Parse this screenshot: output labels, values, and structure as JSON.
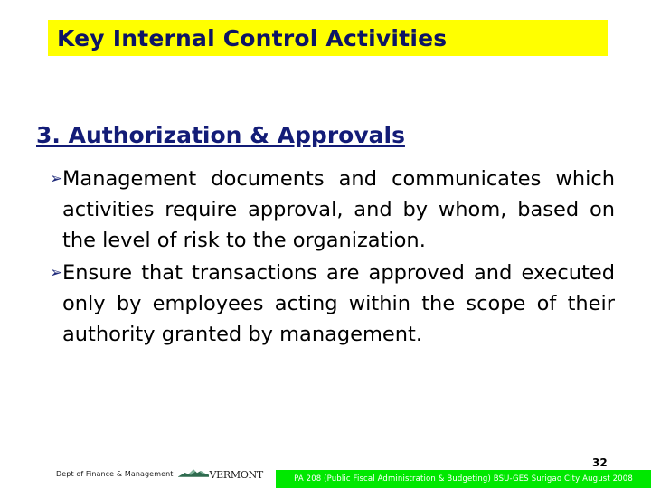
{
  "slide": {
    "title": "Key Internal Control Activities",
    "title_band_color": "#ffff00",
    "title_text_color": "#0d1464",
    "section_heading": "3. Authorization & Approvals",
    "section_heading_color": "#131c77",
    "bullets": [
      {
        "marker": "arrow-bullet-icon",
        "marker_glyph": "➢",
        "text": "Management documents and communicates which activities require approval, and by whom, based on the level of risk to the organization."
      },
      {
        "marker": "arrow-bullet-icon",
        "marker_glyph": "➢",
        "text": "Ensure that transactions are approved and executed only by employees acting within the scope of their authority granted by management."
      }
    ]
  },
  "footer": {
    "department": "Dept of Finance & Management",
    "logo_word": "VERMONT",
    "logo_icon": "vermont-mountain-icon",
    "logo_color": "#2f6b4f",
    "page_number": "32",
    "band_color": "#00e800",
    "band_text": "PA 208 (Public Fiscal Administration & Budgeting) BSU-GES Surigao City August 2008"
  }
}
